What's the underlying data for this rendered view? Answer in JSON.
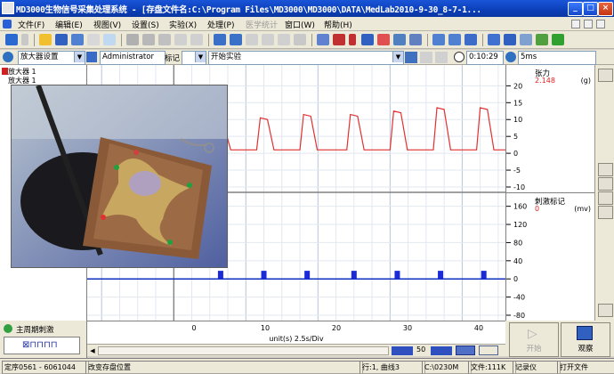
{
  "window": {
    "title": "MD3000生物信号采集处理系统 - [存盘文件名:C:\\Program Files\\MD3000\\MD3000\\DATA\\MedLab2010-9-30_8-7-1..."
  },
  "menu": {
    "items": [
      "文件(F)",
      "编辑(E)",
      "视图(V)",
      "设置(S)",
      "实验(X)",
      "处理(P)",
      "医学统计",
      "窗口(W)",
      "帮助(H)"
    ]
  },
  "controlbar": {
    "amp_setting": "放大器设置",
    "user": "Administrator",
    "mark_label": "标记",
    "experiment": "开始实验",
    "clock": "0:10:29",
    "timebase": "5ms"
  },
  "left_panel": {
    "amplifiers": [
      "放大器 1",
      "放大器 1"
    ],
    "cycle_label": "主周期刺激",
    "cycle_pattern": "⊠⊓⊓⊓⊓"
  },
  "channels": [
    {
      "name": "张力",
      "value": "2.148",
      "unit": "(g)",
      "ticks": [
        "20",
        "15",
        "10",
        "5",
        "0",
        "-5",
        "-10"
      ]
    },
    {
      "name": "刺激标记",
      "value": "0",
      "unit": "(mv)",
      "ticks": [
        "160",
        "120",
        "80",
        "40",
        "0",
        "-40",
        "-80"
      ]
    }
  ],
  "xaxis": {
    "ticks": [
      "0",
      "10",
      "20",
      "30",
      "40"
    ],
    "label": "unit(s) 2.5s/Div"
  },
  "bottom_controls": {
    "zoom_value": "50",
    "start_label": "开始",
    "view_label": "观察"
  },
  "statusbar": {
    "fields": [
      "定序0561 - 6061044",
      "改变存盘位置",
      "行:1, 曲线3",
      "C:\\0230M",
      "文件:111K",
      "记录仪",
      "打开文件"
    ]
  },
  "colors": {
    "title_blue": "#0b3fb8",
    "trace_red": "#e03030",
    "trace_blue": "#1030c0",
    "stim_mark": "#1a2ad8"
  },
  "chart_data": {
    "type": "line",
    "series": [
      {
        "name": "张力",
        "x": [
          6.5,
          12.5,
          18.5,
          25,
          31,
          37,
          43,
          48.5
        ],
        "values": [
          8.5,
          10.5,
          11.5,
          11.5,
          12.5,
          13.5,
          13.5,
          14.5
        ]
      },
      {
        "name": "刺激标记",
        "x": [
          6.5,
          12.5,
          18.5,
          25,
          31,
          37,
          43,
          48.5
        ],
        "values": [
          10,
          10,
          10,
          10,
          10,
          10,
          10,
          10
        ]
      }
    ],
    "xlim": [
      -12,
      46
    ],
    "ylim_top": [
      -10,
      23
    ],
    "ylim_bottom": [
      -80,
      175
    ]
  }
}
